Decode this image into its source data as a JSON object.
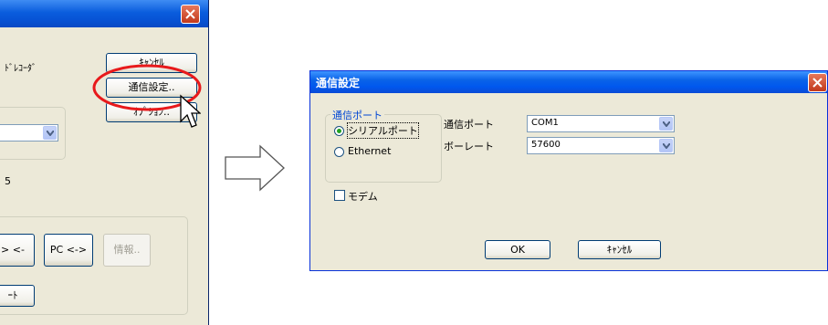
{
  "left_window": {
    "buttons": {
      "cancel": "ｷｬﾝｾﾙ",
      "comm_settings": "通信設定..",
      "options": "ｵﾌﾟｼｮﾝ..",
      "pc_arrow_left_partial": "> <-",
      "pc_bidirectional": "PC <->",
      "info": "情報..",
      "port_partial": "ｰﾄ"
    },
    "recorder_label_partial": "ﾄﾞﾚｺｰﾀﾞ",
    "number_partial": "5"
  },
  "dialog": {
    "title": "通信設定",
    "port_group": {
      "label": "通信ポート",
      "options": [
        "シリアルポート",
        "Ethernet"
      ],
      "selected": "シリアルポート"
    },
    "fields": {
      "comm_port_label": "通信ポート",
      "comm_port_value": "COM1",
      "baud_label": "ボーレート",
      "baud_value": "57600"
    },
    "modem_label": "モデム",
    "modem_checked": false,
    "ok_label": "OK",
    "cancel_label": "ｷｬﾝｾﾙ"
  },
  "colors": {
    "xp_titlebar": "#0a5ddd",
    "window_face": "#ece9d8",
    "highlight_ellipse": "#e8191b",
    "close_button": "#d9532f"
  },
  "icons": [
    "close-icon",
    "dropdown-arrow-icon",
    "mouse-cursor-icon",
    "right-arrow-icon"
  ]
}
